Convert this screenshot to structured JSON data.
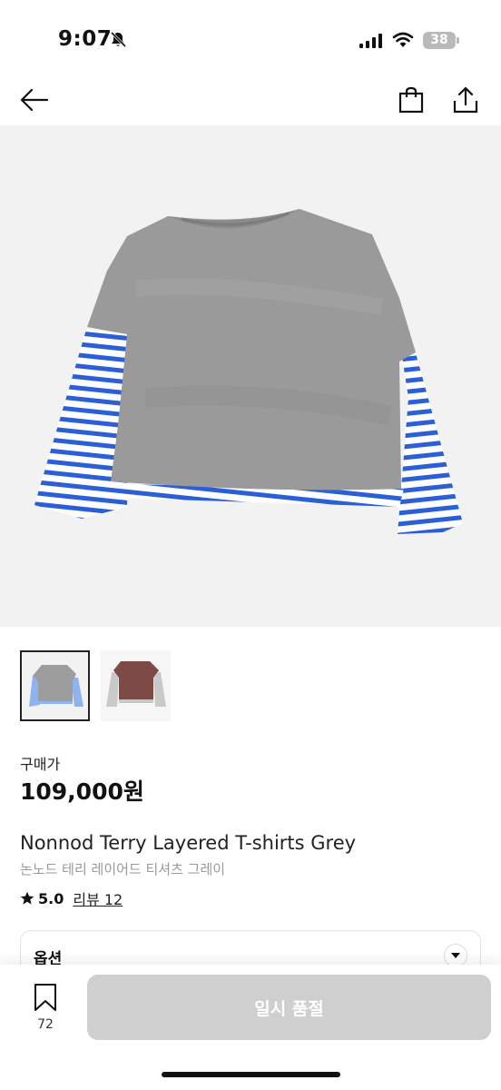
{
  "status_bar": {
    "time": "9:07",
    "battery": "38"
  },
  "nav": {
    "back_icon": "arrow-left-icon",
    "bag_icon": "shopping-bag-icon",
    "share_icon": "share-icon"
  },
  "product": {
    "main_image": "grey terry layered t-shirt with blue-white striped sleeves",
    "thumbnails": [
      {
        "selected": true,
        "color": "grey"
      },
      {
        "selected": false,
        "color": "brown"
      }
    ],
    "price_label": "구매가",
    "price": "109,000원",
    "title_en": "Nonnod Terry Layered T-shirts Grey",
    "title_ko": "논노드 테리 레이어드 티셔츠 그레이",
    "rating": "5.0",
    "reviews": "리뷰 12"
  },
  "options": {
    "label": "옵션"
  },
  "bottom_bar": {
    "wish_count": "72",
    "buy_label": "일시 품절"
  },
  "colors": {
    "accent_stripe": "#2a5fd6",
    "disabled_button": "#cfcfcf"
  }
}
